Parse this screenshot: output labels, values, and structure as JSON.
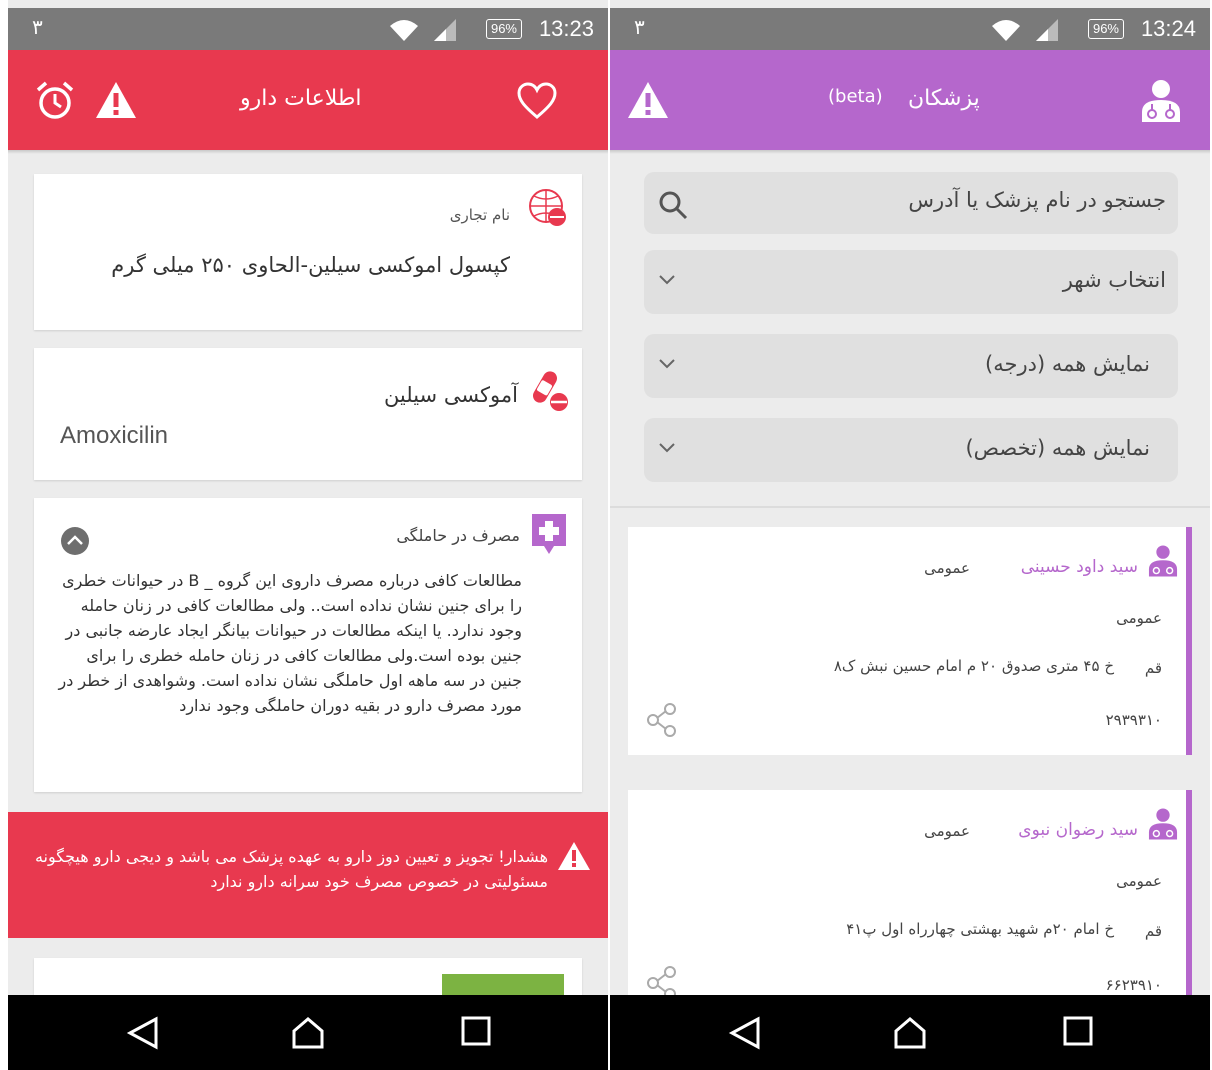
{
  "left": {
    "status": {
      "notif": "۳",
      "battery": "96%",
      "time": "13:23"
    },
    "appbar": {
      "title": "اطلاعات دارو",
      "color": "#e8394f"
    },
    "trade_card": {
      "label": "نام تجاری",
      "value": "کپسول اموکسی سیلین-الحاوی ۲۵۰ میلی گرم"
    },
    "generic_card": {
      "name_fa": "آموکسی سیلین",
      "name_en": "Amoxicilin"
    },
    "pregnancy_card": {
      "label": "مصرف در حاملگی",
      "text": "مطالعات کافی درباره مصرف داروی این گروه _ B در حیوانات خطری را برای جنین نشان نداده است.. ولی مطالعات کافی در زنان حامله وجود ندارد. یا اینکه مطالعات در حیوانات بیانگر ایجاد عارضه جانبی در جنین بوده است.ولی مطالعات کافی در زنان حامله خطری را برای جنین در سه ماهه اول حاملگی نشان نداده است. وشواهدی از خطر در مورد مصرف دارو در بقیه دوران حاملگی وجود ندارد"
    },
    "warning": {
      "text": "هشدار! تجویز و تعیین دوز دارو به عهده پزشک می باشد و دیجی دارو هیچگونه مسئولیتی در خصوص مصرف خود سرانه دارو ندارد"
    }
  },
  "right": {
    "status": {
      "notif": "۳",
      "battery": "96%",
      "time": "13:24"
    },
    "appbar": {
      "title": "پزشکان",
      "beta": "(beta)",
      "color": "#b567cc"
    },
    "search": {
      "placeholder": "جستجو در نام پزشک یا آدرس"
    },
    "city": {
      "value": "انتخاب شهر"
    },
    "degree": {
      "value": "نمایش همه (درجه)"
    },
    "specialty": {
      "value": "نمایش همه (تخصص)"
    },
    "doctors": [
      {
        "name": "سید داود حسینی",
        "type": "عمومی",
        "specialty": "عمومی",
        "city": "قم",
        "address": "خ ۴۵ متری صدوق ۲۰ م امام حسین نبش ک۸",
        "phone": "۲۹۳۹۳۱۰"
      },
      {
        "name": "سید رضوان نبوی",
        "type": "عمومی",
        "specialty": "عمومی",
        "city": "قم",
        "address": "خ امام ۲۰م شهید بهشتی چهارراه اول پ۴۱",
        "phone": "۶۶۲۳۹۱۰"
      }
    ]
  }
}
